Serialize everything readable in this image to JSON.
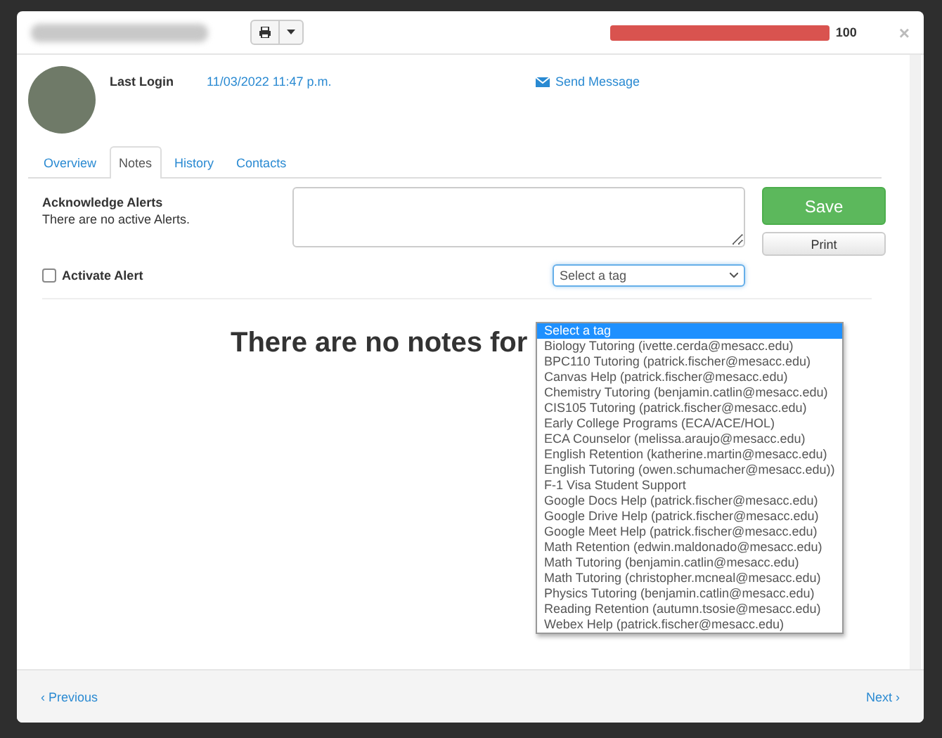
{
  "modal": {
    "progress": {
      "level": 1,
      "value": "100"
    },
    "close": "×",
    "profile": {
      "last_login_label": "Last Login",
      "last_login": "11/03/2022 11:47 p.m.",
      "send_message": "Send Message"
    },
    "tabs": [
      {
        "label": "Overview",
        "selected": false
      },
      {
        "label": "Notes",
        "selected": true
      },
      {
        "label": "History",
        "selected": false
      },
      {
        "label": "Contacts",
        "selected": false
      }
    ],
    "alerts": {
      "title": "Acknowledge Alerts",
      "message": "There are no active Alerts.",
      "activate": {
        "label": "Activate Alert",
        "checked": false
      }
    },
    "save": "Save",
    "print": "Print",
    "tag_select": {
      "value": "Select a tag",
      "expanded": true,
      "options": [
        {
          "label": "Select a tag",
          "selected": true
        },
        {
          "label": "Biology Tutoring (ivette.cerda@mesacc.edu)",
          "selected": false
        },
        {
          "label": "BPC110 Tutoring (patrick.fischer@mesacc.edu)",
          "selected": false
        },
        {
          "label": "Canvas Help (patrick.fischer@mesacc.edu)",
          "selected": false
        },
        {
          "label": "Chemistry Tutoring (benjamin.catlin@mesacc.edu)",
          "selected": false
        },
        {
          "label": "CIS105 Tutoring (patrick.fischer@mesacc.edu)",
          "selected": false
        },
        {
          "label": "Early College Programs (ECA/ACE/HOL)",
          "selected": false
        },
        {
          "label": "ECA Counselor (melissa.araujo@mesacc.edu)",
          "selected": false
        },
        {
          "label": "English Retention (katherine.martin@mesacc.edu)",
          "selected": false
        },
        {
          "label": "English Tutoring (owen.schumacher@mesacc.edu))",
          "selected": false
        },
        {
          "label": "F-1 Visa Student Support",
          "selected": false
        },
        {
          "label": "Google Docs Help (patrick.fischer@mesacc.edu)",
          "selected": false
        },
        {
          "label": "Google Drive Help (patrick.fischer@mesacc.edu)",
          "selected": false
        },
        {
          "label": "Google Meet Help (patrick.fischer@mesacc.edu)",
          "selected": false
        },
        {
          "label": "Math Retention (edwin.maldonado@mesacc.edu)",
          "selected": false
        },
        {
          "label": "Math Tutoring (benjamin.catlin@mesacc.edu)",
          "selected": false
        },
        {
          "label": "Math Tutoring (christopher.mcneal@mesacc.edu)",
          "selected": false
        },
        {
          "label": "Physics Tutoring (benjamin.catlin@mesacc.edu)",
          "selected": false
        },
        {
          "label": "Reading Retention (autumn.tsosie@mesacc.edu)",
          "selected": false
        },
        {
          "label": "Webex Help (patrick.fischer@mesacc.edu)",
          "selected": false
        }
      ]
    },
    "empty_message": "There are no notes for",
    "footer": {
      "previous": "‹ Previous",
      "next": "Next ›"
    }
  }
}
